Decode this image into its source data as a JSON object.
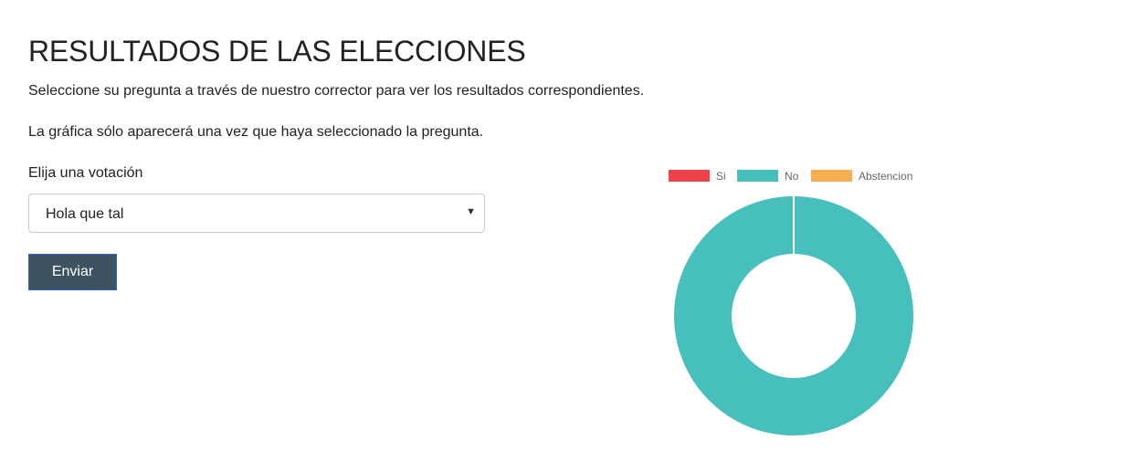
{
  "header": {
    "title": "RESULTADOS DE LAS ELECCIONES",
    "intro_line_1": "Seleccione su pregunta a través de nuestro corrector para ver los resultados correspondientes.",
    "intro_line_2": "La gráfica sólo aparecerá una vez que haya seleccionado la pregunta."
  },
  "form": {
    "label": "Elija una votación",
    "select_value": "Hola que tal",
    "submit_label": "Enviar"
  },
  "colors": {
    "si": "#f0424b",
    "no": "#47bfbd",
    "abstencion": "#f9ae51",
    "button_bg": "#3d5361"
  },
  "chart_data": {
    "type": "pie",
    "variant": "doughnut",
    "legend_position": "top",
    "categories": [
      "Si",
      "No",
      "Abstencion"
    ],
    "values": [
      0,
      1,
      0
    ],
    "colors": [
      "#f0424b",
      "#47bfbd",
      "#f9ae51"
    ]
  }
}
